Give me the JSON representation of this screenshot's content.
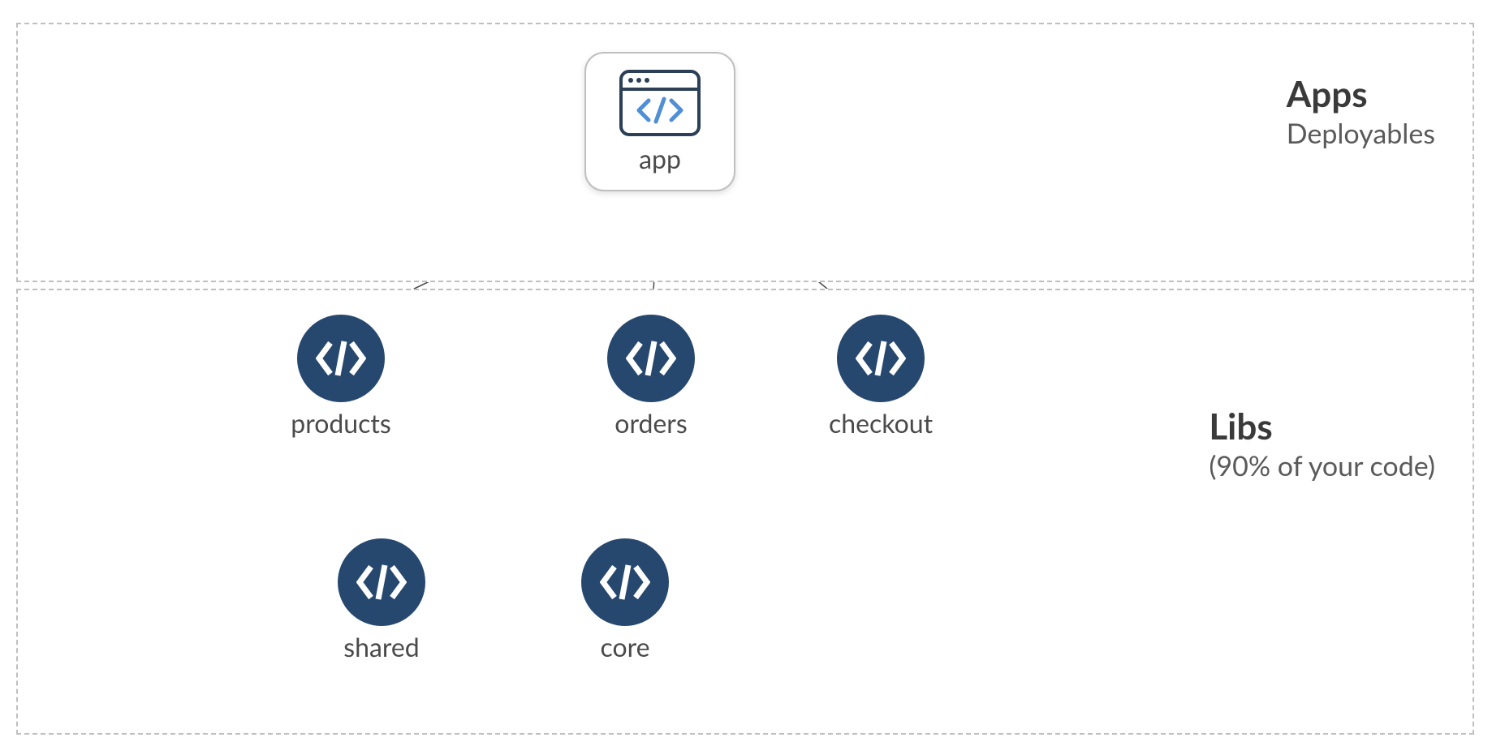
{
  "regions": {
    "apps": {
      "title": "Apps",
      "subtitle": "Deployables"
    },
    "libs": {
      "title": "Libs",
      "subtitle": "(90% of your code)"
    }
  },
  "nodes": {
    "app": {
      "label": "app"
    },
    "products": {
      "label": "products"
    },
    "orders": {
      "label": "orders"
    },
    "checkout": {
      "label": "checkout"
    },
    "shared": {
      "label": "shared"
    },
    "core": {
      "label": "core"
    }
  },
  "colors": {
    "node_fill": "#27486e",
    "border": "#bfbfbf",
    "accent_blue": "#4f8fd6",
    "text_dark": "#3a3a3a",
    "text_med": "#5a5a5a"
  },
  "edges": [
    {
      "from": "app",
      "to": "products"
    },
    {
      "from": "app",
      "to": "orders"
    },
    {
      "from": "app",
      "to": "checkout"
    },
    {
      "from": "orders",
      "to": "products"
    },
    {
      "from": "products",
      "to": "shared"
    },
    {
      "from": "products",
      "to": "core"
    },
    {
      "from": "orders",
      "to": "core"
    },
    {
      "from": "checkout",
      "to": "core"
    }
  ]
}
